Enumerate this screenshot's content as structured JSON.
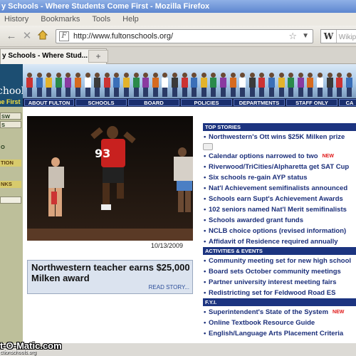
{
  "window": {
    "title": "y Schools - Where Students Come First - Mozilla Firefox"
  },
  "menu": [
    "History",
    "Bookmarks",
    "Tools",
    "Help"
  ],
  "toolbar": {
    "back_icon": "back-arrow-icon",
    "stop_icon": "stop-icon",
    "home_icon": "home-icon"
  },
  "address": {
    "url": "http://www.fultonschools.org/"
  },
  "search": {
    "engine": "W",
    "placeholder": "Wikip"
  },
  "tabs": [
    {
      "label": "y Schools - Where Stud..."
    }
  ],
  "newtab_label": "+",
  "site": {
    "logo": {
      "name": "chools",
      "tagline": "ne First"
    },
    "nav": [
      "ABOUT FULTON",
      "SCHOOLS",
      "BOARD",
      "POLICIES",
      "DEPARTMENTS",
      "STAFF ONLY",
      "CA"
    ],
    "leftnav": [
      "SW",
      "S",
      "O",
      "TION",
      "NKS"
    ]
  },
  "feature": {
    "jersey_number": "93",
    "date": "10/13/2009",
    "headline": "Northwestern teacher earns $25,000 Milken award",
    "read_more": "READ STORY..."
  },
  "top_stories": {
    "heading": "TOP STORIES",
    "items": [
      {
        "text": "Northwestern's Ott wins $25K Milken prize",
        "new": ""
      },
      {
        "text": "Calendar options narrowed to two",
        "new": "NEW"
      },
      {
        "text": "Riverwood/TriCities/Alpharetta get SAT Cup",
        "new": ""
      },
      {
        "text": "Six schools re-gain AYP status",
        "new": ""
      },
      {
        "text": "Nat'l Achievement semifinalists announced",
        "new": ""
      },
      {
        "text": "Schools earn Supt's Achievement Awards",
        "new": ""
      },
      {
        "text": "102 seniors named Nat'l Merit semifinalists",
        "new": ""
      },
      {
        "text": "Schools awarded grant funds",
        "new": ""
      },
      {
        "text": "NCLB choice options (revised information)",
        "new": ""
      },
      {
        "text": "Affidavit of Residence required annually",
        "new": ""
      }
    ]
  },
  "activities": {
    "heading": "ACTIVITIES & EVENTS",
    "items": [
      {
        "text": "Community meeting set for new high school"
      },
      {
        "text": "Board sets October community meetings"
      },
      {
        "text": "Partner university interest meeting fairs"
      },
      {
        "text": "Redistricting set for Feldwood Road ES"
      }
    ]
  },
  "fyi": {
    "heading": "F.Y.I.",
    "items": [
      {
        "text": "Superintendent's State of the System",
        "new": "NEW"
      },
      {
        "text": "Online Textbook Resource Guide",
        "new": ""
      },
      {
        "text": "English/Language Arts Placement Criteria",
        "new": ""
      }
    ]
  },
  "watermark": {
    "text": "t-O-Matic.com",
    "sub": "ctionschools.org"
  }
}
